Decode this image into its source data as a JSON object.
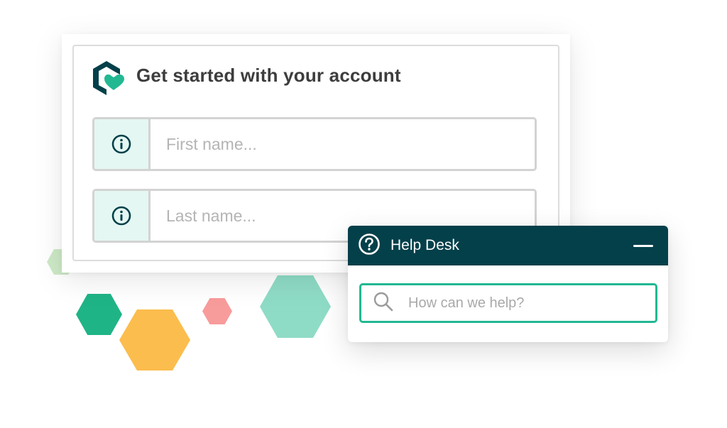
{
  "colors": {
    "accent": "#22b892",
    "header_dark": "#04404a",
    "info_bg": "#e4f7f2",
    "title_text": "#3d3d3d"
  },
  "account_card": {
    "logo_icon": "brand-logo-icon",
    "title": "Get started with your account",
    "fields": [
      {
        "icon": "info-icon",
        "placeholder": "First name...",
        "value": ""
      },
      {
        "icon": "info-icon",
        "placeholder": "Last name...",
        "value": ""
      }
    ]
  },
  "help_desk": {
    "icon": "question-circle-icon",
    "title": "Help Desk",
    "minimize_icon": "minimize-icon",
    "search": {
      "icon": "search-icon",
      "placeholder": "How can we help?",
      "value": ""
    }
  }
}
